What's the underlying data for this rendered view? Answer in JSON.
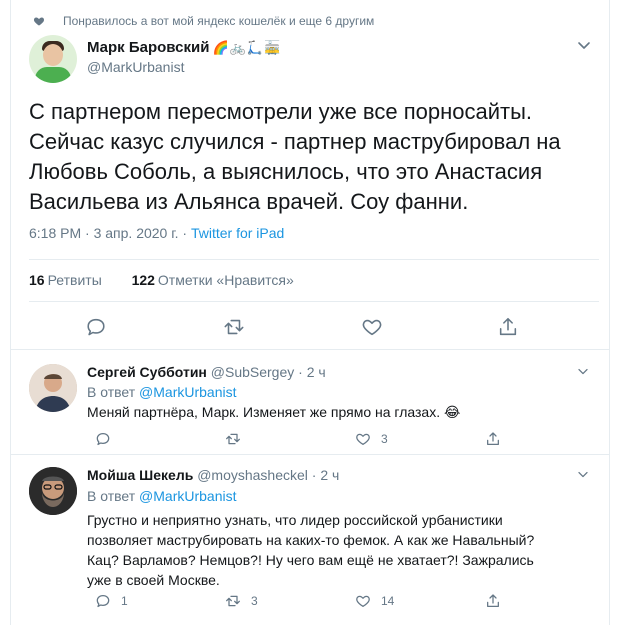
{
  "social_context": "Понравилось а вот мой яндекс кошелёк и еще 6 другим",
  "main_tweet": {
    "author_name": "Марк Баровский",
    "author_emoji": "🌈🚲🛴🚋",
    "author_handle": "@MarkUrbanist",
    "text": "С партнером пересмотрели уже все порносайты.\nСейчас казус случился - партнер маструбировал на\nЛюбовь Соболь, а выяснилось, что это Анастасия\nВасильева из Альянса врачей. Соу фанни.",
    "timestamp": "6:18 PM · 3 апр. 2020 г. · ",
    "client": "Twitter for iPad",
    "retweets_count": "16",
    "retweets_label": "Ретвиты",
    "likes_count": "122",
    "likes_label": "Отметки «Нравится»"
  },
  "replies": [
    {
      "name": "Сергей Субботин",
      "handle": "@SubSergey · 2 ч",
      "reply_prefix": "В ответ ",
      "reply_to": "@MarkUrbanist",
      "text": "Меняй партнёра, Марк. Изменяет же прямо на глазах. 😂",
      "reply_count": "",
      "retweet_count": "",
      "like_count": "3"
    },
    {
      "name": "Мойша Шекель",
      "handle": "@moyshasheckel · 2 ч",
      "reply_prefix": "В ответ ",
      "reply_to": "@MarkUrbanist",
      "text": "Грустно и неприятно узнать, что лидер российской урбанистики позволяет маструбировать на каких-то фемок. А как же Навальный? Кац? Варламов? Немцов?! Ну чего вам ещё не хватает?! Зажрались уже в своей Москве.",
      "reply_count": "1",
      "retweet_count": "3",
      "like_count": "14"
    }
  ],
  "icons": {
    "heart": "heart-icon",
    "reply": "reply-icon",
    "retweet": "retweet-icon",
    "like": "like-icon",
    "share": "share-icon",
    "chevron": "chevron-down-icon"
  },
  "colors": {
    "accent": "#1b95e0",
    "muted": "#657786",
    "text": "#14171a",
    "border": "#e6ecf0"
  }
}
